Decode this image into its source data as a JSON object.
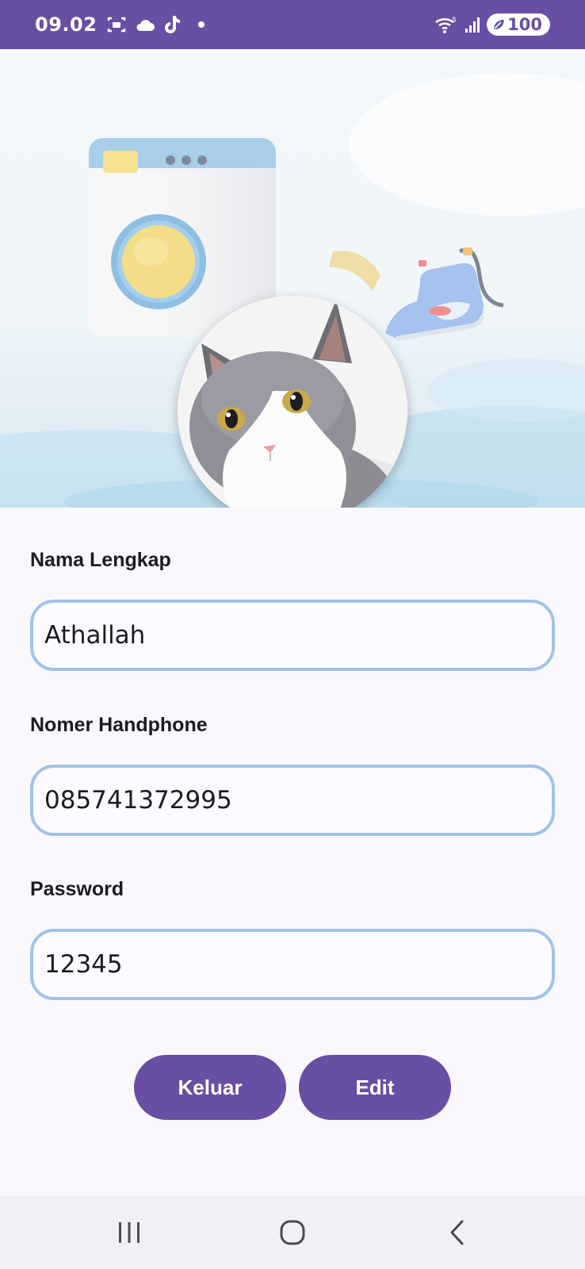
{
  "status_bar": {
    "time": "09.02",
    "battery": "100",
    "network_label": "5"
  },
  "hero": {
    "illustration": "laundry-washing-machine-and-iron",
    "avatar_alt": "profile photo of a grey and white cat"
  },
  "form": {
    "name_label": "Nama Lengkap",
    "name_value": "Athallah",
    "phone_label": "Nomer Handphone",
    "phone_value": "085741372995",
    "password_label": "Password",
    "password_value": "12345"
  },
  "actions": {
    "logout_label": "Keluar",
    "edit_label": "Edit"
  },
  "colors": {
    "primary": "#684fa3",
    "field_border": "#9fc3e8",
    "background": "#fbf8fd"
  }
}
